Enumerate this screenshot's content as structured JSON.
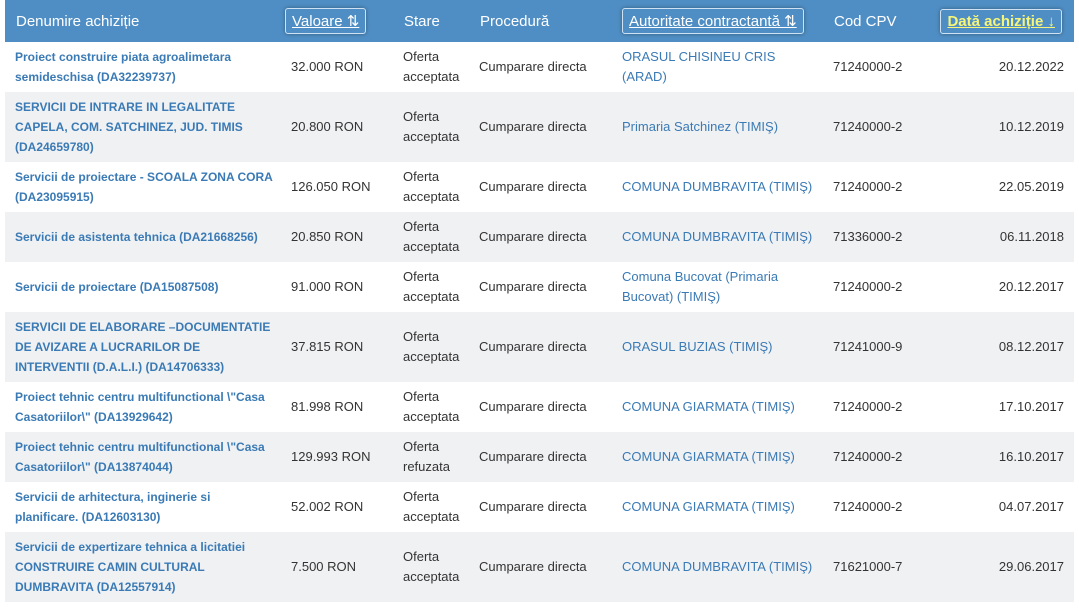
{
  "headers": {
    "name": "Denumire achiziție",
    "value": "Valoare ⇅",
    "state": "Stare",
    "procedure": "Procedură",
    "authority": "Autoritate contractantă ⇅",
    "cpv": "Cod CPV",
    "date": "Dată achiziție ↓"
  },
  "colors": {
    "header_bg": "#4f8ec4",
    "link": "#3a7ab5",
    "active_sort": "#f6f57a",
    "row_alt": "#f0f1f3"
  },
  "rows": [
    {
      "name": "Proiect construire piata agroalimetara semideschisa (DA32239737)",
      "value": "32.000 RON",
      "state": "Oferta acceptata",
      "procedure": "Cumparare directa",
      "authority": "ORASUL CHISINEU CRIS (ARAD)",
      "cpv": "71240000-2",
      "date": "20.12.2022"
    },
    {
      "name": "SERVICII DE INTRARE IN LEGALITATE CAPELA, COM. SATCHINEZ, JUD. TIMIS (DA24659780)",
      "value": "20.800 RON",
      "state": "Oferta acceptata",
      "procedure": "Cumparare directa",
      "authority": "Primaria Satchinez (TIMIŞ)",
      "cpv": "71240000-2",
      "date": "10.12.2019"
    },
    {
      "name": "Servicii de proiectare - SCOALA ZONA CORA (DA23095915)",
      "value": "126.050 RON",
      "state": "Oferta acceptata",
      "procedure": "Cumparare directa",
      "authority": "COMUNA DUMBRAVITA (TIMIŞ)",
      "cpv": "71240000-2",
      "date": "22.05.2019"
    },
    {
      "name": "Servicii de asistenta tehnica (DA21668256)",
      "value": "20.850 RON",
      "state": "Oferta acceptata",
      "procedure": "Cumparare directa",
      "authority": "COMUNA DUMBRAVITA (TIMIŞ)",
      "cpv": "71336000-2",
      "date": "06.11.2018"
    },
    {
      "name": "Servicii de proiectare (DA15087508)",
      "value": "91.000 RON",
      "state": "Oferta acceptata",
      "procedure": "Cumparare directa",
      "authority": "Comuna Bucovat (Primaria Bucovat) (TIMIŞ)",
      "cpv": "71240000-2",
      "date": "20.12.2017"
    },
    {
      "name": "SERVICII DE ELABORARE –DOCUMENTATIE DE AVIZARE A LUCRARILOR DE INTERVENTII (D.A.L.I.) (DA14706333)",
      "value": "37.815 RON",
      "state": "Oferta acceptata",
      "procedure": "Cumparare directa",
      "authority": "ORASUL BUZIAS (TIMIŞ)",
      "cpv": "71241000-9",
      "date": "08.12.2017"
    },
    {
      "name": "Proiect tehnic centru multifunctional \\\"Casa Casatoriilor\\\" (DA13929642)",
      "value": "81.998 RON",
      "state": "Oferta acceptata",
      "procedure": "Cumparare directa",
      "authority": "COMUNA GIARMATA (TIMIŞ)",
      "cpv": "71240000-2",
      "date": "17.10.2017"
    },
    {
      "name": "Proiect tehnic centru multifunctional \\\"Casa Casatoriilor\\\" (DA13874044)",
      "value": "129.993 RON",
      "state": "Oferta refuzata",
      "procedure": "Cumparare directa",
      "authority": "COMUNA GIARMATA (TIMIŞ)",
      "cpv": "71240000-2",
      "date": "16.10.2017"
    },
    {
      "name": "Servicii de arhitectura, inginerie si planificare. (DA12603130)",
      "value": "52.002 RON",
      "state": "Oferta acceptata",
      "procedure": "Cumparare directa",
      "authority": "COMUNA GIARMATA (TIMIŞ)",
      "cpv": "71240000-2",
      "date": "04.07.2017"
    },
    {
      "name": "Servicii de expertizare tehnica a licitatiei CONSTRUIRE CAMIN CULTURAL DUMBRAVITA (DA12557914)",
      "value": "7.500 RON",
      "state": "Oferta acceptata",
      "procedure": "Cumparare directa",
      "authority": "COMUNA DUMBRAVITA (TIMIŞ)",
      "cpv": "71621000-7",
      "date": "29.06.2017"
    }
  ]
}
